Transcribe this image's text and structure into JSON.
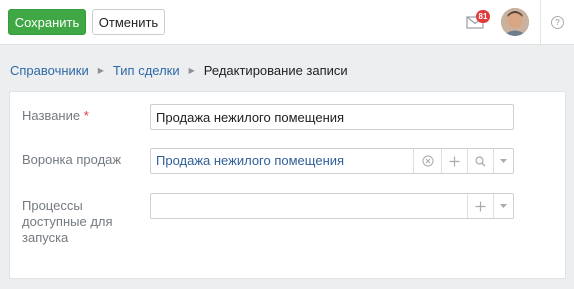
{
  "toolbar": {
    "save_label": "Сохранить",
    "cancel_label": "Отменить",
    "notifications_count": "81",
    "help_glyph": "?"
  },
  "breadcrumb": {
    "items": [
      "Справочники",
      "Тип сделки"
    ],
    "current": "Редактирование записи"
  },
  "form": {
    "name": {
      "label": "Название",
      "required_mark": "*",
      "value": "Продажа нежилого помещения"
    },
    "funnel": {
      "label": "Воронка продаж",
      "value": "Продажа нежилого помещения"
    },
    "processes": {
      "label_lines": [
        "Процессы",
        "доступные для",
        "запуска"
      ],
      "value": ""
    }
  },
  "icons": [
    "mail-icon",
    "clear-icon",
    "plus-icon",
    "search-icon",
    "chevron-down-icon",
    "help-icon"
  ],
  "colors": {
    "save_button": "#3fa844",
    "link": "#2f6aa6",
    "badge": "#e23b3b",
    "required": "#e0393e"
  }
}
